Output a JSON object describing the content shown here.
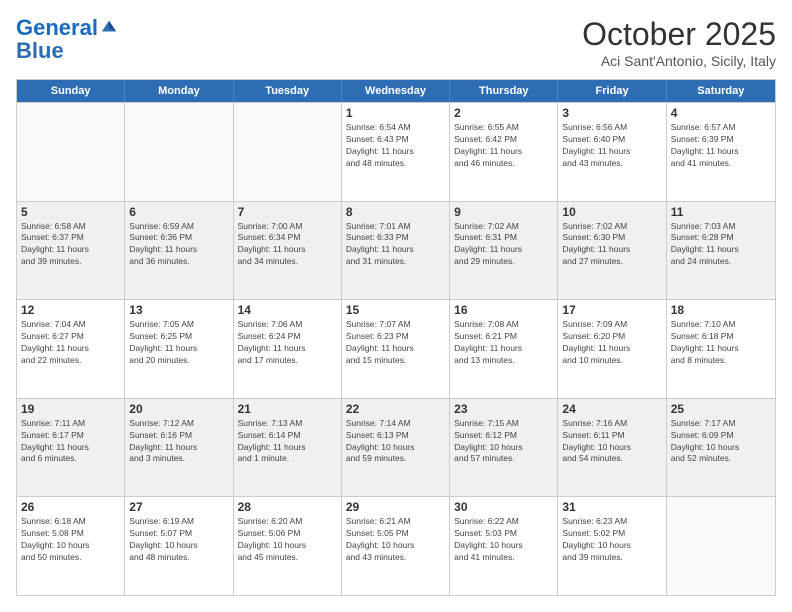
{
  "header": {
    "logo_line1": "General",
    "logo_line2": "Blue",
    "month": "October 2025",
    "location": "Aci Sant'Antonio, Sicily, Italy"
  },
  "weekdays": [
    "Sunday",
    "Monday",
    "Tuesday",
    "Wednesday",
    "Thursday",
    "Friday",
    "Saturday"
  ],
  "rows": [
    [
      {
        "day": "",
        "info": ""
      },
      {
        "day": "",
        "info": ""
      },
      {
        "day": "",
        "info": ""
      },
      {
        "day": "1",
        "info": "Sunrise: 6:54 AM\nSunset: 6:43 PM\nDaylight: 11 hours\nand 48 minutes."
      },
      {
        "day": "2",
        "info": "Sunrise: 6:55 AM\nSunset: 6:42 PM\nDaylight: 11 hours\nand 46 minutes."
      },
      {
        "day": "3",
        "info": "Sunrise: 6:56 AM\nSunset: 6:40 PM\nDaylight: 11 hours\nand 43 minutes."
      },
      {
        "day": "4",
        "info": "Sunrise: 6:57 AM\nSunset: 6:39 PM\nDaylight: 11 hours\nand 41 minutes."
      }
    ],
    [
      {
        "day": "5",
        "info": "Sunrise: 6:58 AM\nSunset: 6:37 PM\nDaylight: 11 hours\nand 39 minutes."
      },
      {
        "day": "6",
        "info": "Sunrise: 6:59 AM\nSunset: 6:36 PM\nDaylight: 11 hours\nand 36 minutes."
      },
      {
        "day": "7",
        "info": "Sunrise: 7:00 AM\nSunset: 6:34 PM\nDaylight: 11 hours\nand 34 minutes."
      },
      {
        "day": "8",
        "info": "Sunrise: 7:01 AM\nSunset: 6:33 PM\nDaylight: 11 hours\nand 31 minutes."
      },
      {
        "day": "9",
        "info": "Sunrise: 7:02 AM\nSunset: 6:31 PM\nDaylight: 11 hours\nand 29 minutes."
      },
      {
        "day": "10",
        "info": "Sunrise: 7:02 AM\nSunset: 6:30 PM\nDaylight: 11 hours\nand 27 minutes."
      },
      {
        "day": "11",
        "info": "Sunrise: 7:03 AM\nSunset: 6:28 PM\nDaylight: 11 hours\nand 24 minutes."
      }
    ],
    [
      {
        "day": "12",
        "info": "Sunrise: 7:04 AM\nSunset: 6:27 PM\nDaylight: 11 hours\nand 22 minutes."
      },
      {
        "day": "13",
        "info": "Sunrise: 7:05 AM\nSunset: 6:25 PM\nDaylight: 11 hours\nand 20 minutes."
      },
      {
        "day": "14",
        "info": "Sunrise: 7:06 AM\nSunset: 6:24 PM\nDaylight: 11 hours\nand 17 minutes."
      },
      {
        "day": "15",
        "info": "Sunrise: 7:07 AM\nSunset: 6:23 PM\nDaylight: 11 hours\nand 15 minutes."
      },
      {
        "day": "16",
        "info": "Sunrise: 7:08 AM\nSunset: 6:21 PM\nDaylight: 11 hours\nand 13 minutes."
      },
      {
        "day": "17",
        "info": "Sunrise: 7:09 AM\nSunset: 6:20 PM\nDaylight: 11 hours\nand 10 minutes."
      },
      {
        "day": "18",
        "info": "Sunrise: 7:10 AM\nSunset: 6:18 PM\nDaylight: 11 hours\nand 8 minutes."
      }
    ],
    [
      {
        "day": "19",
        "info": "Sunrise: 7:11 AM\nSunset: 6:17 PM\nDaylight: 11 hours\nand 6 minutes."
      },
      {
        "day": "20",
        "info": "Sunrise: 7:12 AM\nSunset: 6:16 PM\nDaylight: 11 hours\nand 3 minutes."
      },
      {
        "day": "21",
        "info": "Sunrise: 7:13 AM\nSunset: 6:14 PM\nDaylight: 11 hours\nand 1 minute."
      },
      {
        "day": "22",
        "info": "Sunrise: 7:14 AM\nSunset: 6:13 PM\nDaylight: 10 hours\nand 59 minutes."
      },
      {
        "day": "23",
        "info": "Sunrise: 7:15 AM\nSunset: 6:12 PM\nDaylight: 10 hours\nand 57 minutes."
      },
      {
        "day": "24",
        "info": "Sunrise: 7:16 AM\nSunset: 6:11 PM\nDaylight: 10 hours\nand 54 minutes."
      },
      {
        "day": "25",
        "info": "Sunrise: 7:17 AM\nSunset: 6:09 PM\nDaylight: 10 hours\nand 52 minutes."
      }
    ],
    [
      {
        "day": "26",
        "info": "Sunrise: 6:18 AM\nSunset: 5:08 PM\nDaylight: 10 hours\nand 50 minutes."
      },
      {
        "day": "27",
        "info": "Sunrise: 6:19 AM\nSunset: 5:07 PM\nDaylight: 10 hours\nand 48 minutes."
      },
      {
        "day": "28",
        "info": "Sunrise: 6:20 AM\nSunset: 5:06 PM\nDaylight: 10 hours\nand 45 minutes."
      },
      {
        "day": "29",
        "info": "Sunrise: 6:21 AM\nSunset: 5:05 PM\nDaylight: 10 hours\nand 43 minutes."
      },
      {
        "day": "30",
        "info": "Sunrise: 6:22 AM\nSunset: 5:03 PM\nDaylight: 10 hours\nand 41 minutes."
      },
      {
        "day": "31",
        "info": "Sunrise: 6:23 AM\nSunset: 5:02 PM\nDaylight: 10 hours\nand 39 minutes."
      },
      {
        "day": "",
        "info": ""
      }
    ]
  ]
}
